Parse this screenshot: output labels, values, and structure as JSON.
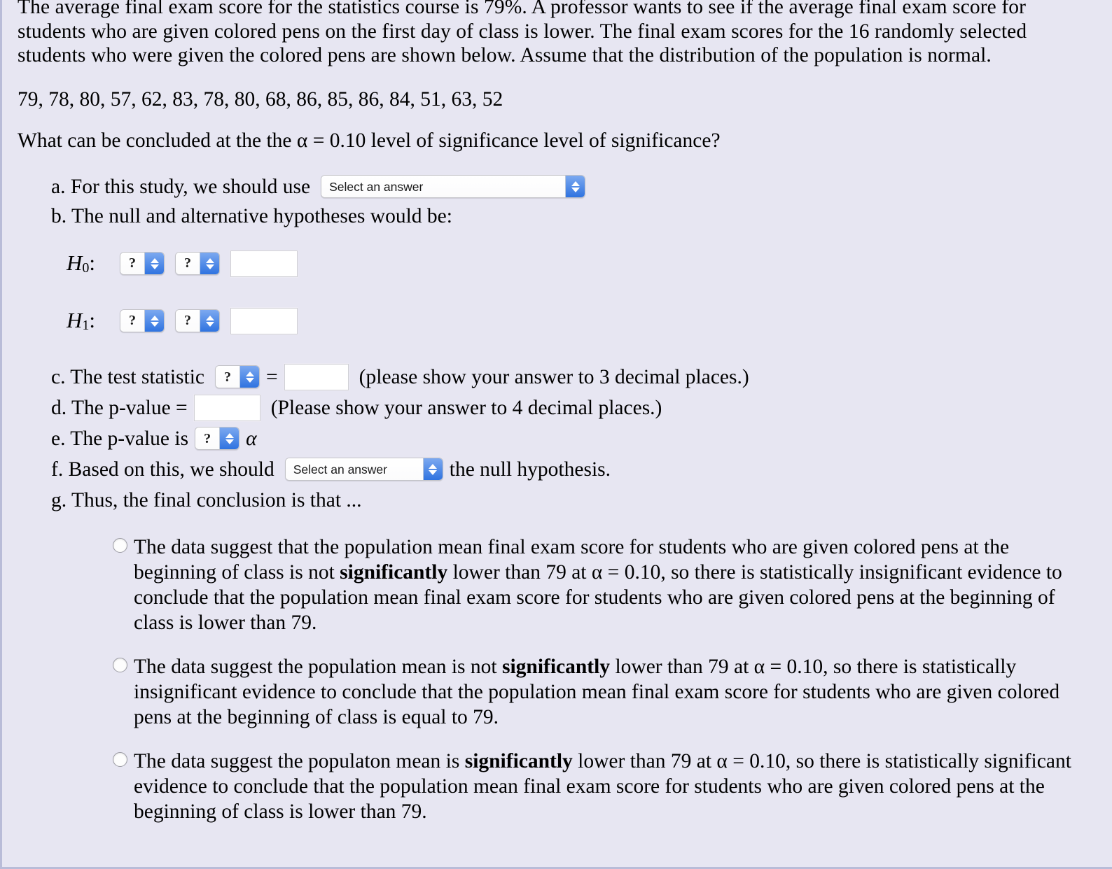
{
  "problem": {
    "intro": "The average final exam score for the statistics course is 79%. A professor wants to see if the average final exam score for students who are given colored pens on the first day of class is lower. The final exam scores for the 16 randomly selected students who were given the colored pens are shown below. Assume that the distribution of the population is normal.",
    "data_values": "79, 78, 80, 57, 62, 83, 78, 80, 68, 86, 85, 86, 84, 51, 63, 52",
    "question": "What can be concluded at the the α = 0.10 level of significance level of significance?"
  },
  "parts": {
    "a": {
      "label": "a. For this study, we should use",
      "select_value": "Select an answer"
    },
    "b": {
      "label": "b. The null and alternative hypotheses would be:",
      "h0_label": "H",
      "h0_sub": "0",
      "h1_label": "H",
      "h1_sub": "1",
      "colon": ":",
      "select_placeholder": "?",
      "input_value": ""
    },
    "c": {
      "label": "c. The test statistic",
      "select_value": "?",
      "equals": "=",
      "input_value": "",
      "hint": "(please show your answer to 3 decimal places.)"
    },
    "d": {
      "label": "d. The p-value =",
      "input_value": "",
      "hint": "(Please show your answer to 4 decimal places.)"
    },
    "e": {
      "label": "e. The p-value is",
      "select_value": "?",
      "alpha": "α"
    },
    "f": {
      "label_before": "f. Based on this, we should",
      "select_value": "Select an answer",
      "label_after": "the null hypothesis."
    },
    "g": {
      "label": "g. Thus, the final conclusion is that ..."
    }
  },
  "conclusion_options": [
    {
      "pre": "The data suggest that the population mean final exam score for students who are given colored pens at the beginning of class is not ",
      "bold": "significantly",
      "post": " lower than 79 at α = 0.10, so there is statistically insignificant evidence to conclude that the population mean final exam score for students who are given colored pens at the beginning of class is lower than 79."
    },
    {
      "pre": "The data suggest the population mean is not ",
      "bold": "significantly",
      "post": " lower than 79 at α = 0.10, so there is statistically insignificant evidence to conclude that the population mean final exam score for students who are given colored pens at the beginning of class is equal to 79."
    },
    {
      "pre": "The data suggest the populaton mean is ",
      "bold": "significantly",
      "post": " lower than 79 at α = 0.10, so there is statistically significant evidence to conclude that the population mean final exam score for students who are given colored pens at the beginning of class is lower than 79."
    }
  ],
  "colors": {
    "background": "#e7e6f2",
    "select_arrow": "#2f73e0",
    "border": "#b9bcd8"
  }
}
